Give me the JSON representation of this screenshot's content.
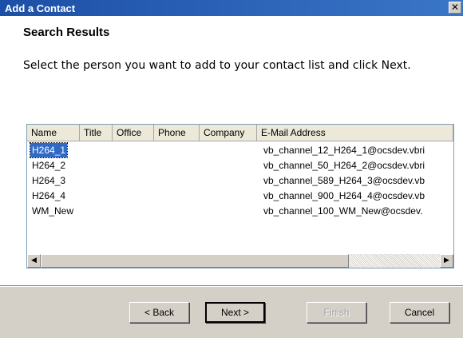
{
  "window": {
    "title": "Add a Contact",
    "close_glyph": "✕",
    "close_icon": "close-icon"
  },
  "content": {
    "heading": "Search Results",
    "instructions": "Select the person you want to add to your contact list and click Next."
  },
  "list": {
    "columns": [
      "Name",
      "Title",
      "Office",
      "Phone",
      "Company",
      "E-Mail Address"
    ],
    "rows": [
      {
        "name": "H264_1",
        "email": "vb_channel_12_H264_1@ocsdev.vbri",
        "selected": true
      },
      {
        "name": "H264_2",
        "email": "vb_channel_50_H264_2@ocsdev.vbri",
        "selected": false
      },
      {
        "name": "H264_3",
        "email": "vb_channel_589_H264_3@ocsdev.vb",
        "selected": false
      },
      {
        "name": "H264_4",
        "email": "vb_channel_900_H264_4@ocsdev.vb",
        "selected": false
      },
      {
        "name": "WM_New",
        "email": "vb_channel_100_WM_New@ocsdev.",
        "selected": false
      }
    ]
  },
  "scroll": {
    "left_arrow": "◀",
    "right_arrow": "▶"
  },
  "buttons": {
    "back": "< Back",
    "next": "Next >",
    "finish": "Finish",
    "cancel": "Cancel"
  },
  "colors": {
    "title_bar": "#1c4fa6",
    "selection": "#316ac5",
    "dialog_bg": "#d4d0c8"
  }
}
